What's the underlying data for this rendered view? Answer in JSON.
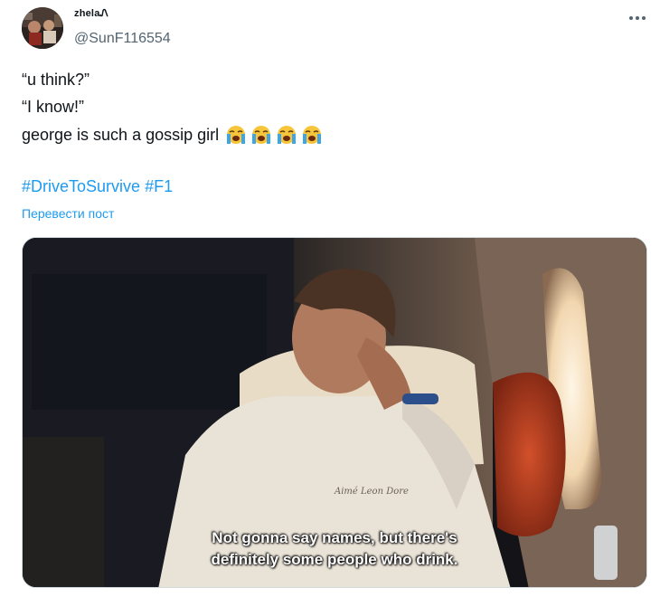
{
  "author": {
    "display_name": "zhelaᏁ",
    "handle": "@SunF116554"
  },
  "tweet": {
    "lines": [
      "“u think?”",
      "“I know!”",
      "george is such a gossip girl"
    ],
    "emoji": [
      "loudly-crying-face",
      "loudly-crying-face",
      "loudly-crying-face",
      "loudly-crying-face"
    ],
    "hashtags": [
      "#DriveToSurvive",
      "#F1"
    ],
    "translate_label": "Перевести пост"
  },
  "media": {
    "subtitle_lines": [
      "Not gonna say names, but there's",
      "definitely some people who drink."
    ],
    "shirt_text": "Aimé Leon Dore"
  },
  "colors": {
    "link": "#1d9bf0",
    "text": "#0f1419",
    "secondary": "#536471"
  }
}
